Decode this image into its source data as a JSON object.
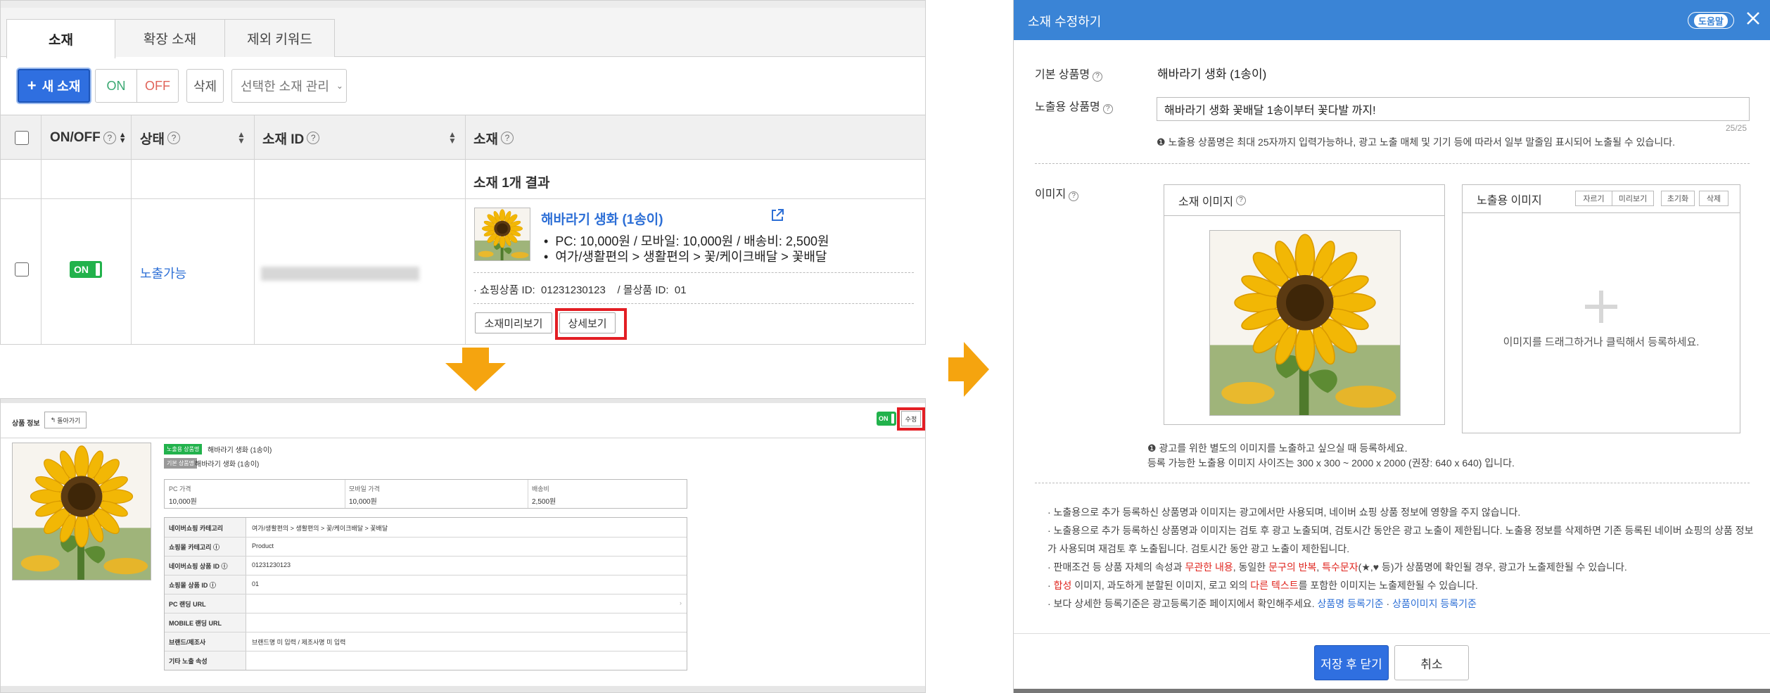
{
  "list_panel": {
    "tabs": [
      "소재",
      "확장 소재",
      "제외 키워드"
    ],
    "toolbar": {
      "new_label": "새 소재",
      "on_label": "ON",
      "off_label": "OFF",
      "delete_label": "삭제",
      "manage_label": "선택한 소재 관리"
    },
    "columns": [
      "ON/OFF",
      "상태",
      "소재 ID",
      "소재"
    ],
    "result_text": "소재 1개 결과",
    "row": {
      "toggle_label": "ON",
      "status": "노출가능",
      "product_title": "해바라기 생화 (1송이)",
      "bullet_1": "PC: 10,000원 / 모바일: 10,000원 / 배송비: 2,500원",
      "bullet_2": "여가/생활편의 > 생활편의 > 꽃/케이크배달 > 꽃배달",
      "ids_text": "· 쇼핑상품 ID:  01231230123    / 몰상품 ID:  01",
      "preview_btn": "소재미리보기",
      "detail_btn": "상세보기"
    }
  },
  "detail_panel": {
    "title": "상품 정보",
    "back_btn": "돌아가기",
    "on_label": "ON",
    "edit_btn": "수정",
    "badge_exposed": "노출용 상품명",
    "exposed_name": "해바라기 생화 (1송이)",
    "badge_basic": "기본 상품명",
    "basic_name": "해바라기 생화 (1송이)",
    "price_headers": [
      "PC 가격",
      "모바일 가격",
      "배송비"
    ],
    "price_values": [
      "10,000원",
      "10,000원",
      "2,500원"
    ],
    "rows": [
      {
        "label": "네이버쇼핑 카테고리",
        "value": "여가/생활편의 > 생활편의 > 꽃/케이크배달 > 꽃배달"
      },
      {
        "label": "쇼핑몰 카테고리",
        "value": "Product"
      },
      {
        "label": "네이버쇼핑 상품 ID",
        "value": "01231230123"
      },
      {
        "label": "쇼핑몰 상품 ID",
        "value": "01"
      },
      {
        "label": "PC 랜딩 URL",
        "value": ""
      },
      {
        "label": "MOBILE 랜딩 URL",
        "value": ""
      },
      {
        "label": "브랜드/제조사",
        "value": "브랜드명 미 입력 / 제조사명 미 입력"
      },
      {
        "label": "기타 노출 속성",
        "value": ""
      }
    ]
  },
  "modal": {
    "title": "소재 수정하기",
    "help_btn": "도움말",
    "close_icon": "close-icon",
    "basic_label": "기본 상품명",
    "basic_value": "해바라기 생화 (1송이)",
    "exposed_label": "노출용 상품명",
    "exposed_value": "해바라기 생화 꽃배달 1송이부터 꽃다발 까지!",
    "char_count": "25/25",
    "exposed_note": "노출용 상품명은 최대 25자까지 입력가능하나, 광고 노출 매체 및 기기 등에 따라서 일부 말줄임 표시되어 노출될 수 있습니다.",
    "image_label": "이미지",
    "ad_image_title": "소재 이미지",
    "exposed_image_title": "노출용 이미지",
    "image_buttons": [
      "자르기",
      "미리보기",
      "초기화",
      "삭제"
    ],
    "drop_text": "이미지를 드래그하거나 클릭해서 등록하세요.",
    "image_note_1": "광고를 위한 별도의 이미지를 노출하고 싶으실 때 등록하세요.",
    "image_note_2": "등록 가능한 노출용 이미지 사이즈는 300 x 300 ~ 2000 x 2000 (권장: 640 x 640) 입니다.",
    "guides": {
      "g1": "· 노출용으로 추가 등록하신 상품명과 이미지는 광고에서만 사용되며, 네이버 쇼핑 상품 정보에 영향을 주지 않습니다.",
      "g2a": "· 노출용으로 추가 등록하신 상품명과 이미지는 검토 후 광고 노출되며, 검토시간 동안은 광고 노출이 제한됩니다. 노출용 정보를 삭제하면 기존 등록된 네이버 쇼핑의 상품 정보",
      "g2b": "가 사용되며 재검토 후 노출됩니다. 검토시간 동안 광고 노출이 제한됩니다.",
      "g3_pre": "· 판매조건 등 상품 자체의 속성과 ",
      "g3_r1": "무관한 내용",
      "g3_mid1": ", 동일한 ",
      "g3_r2": "문구의 반복",
      "g3_mid2": ", ",
      "g3_r3": "특수문자",
      "g3_post": "(★,♥ 등)가 상품명에 확인될 경우, 광고가 노출제한될 수 있습니다.",
      "g4_pre": "· ",
      "g4_r1": "합성",
      "g4_mid": " 이미지, 과도하게 분할된 이미지, 로고 외의 ",
      "g4_r2": "다른 텍스트",
      "g4_post": "를 포함한 이미지는 노출제한될 수 있습니다.",
      "g5_pre": "· 보다 상세한 등록기준은 광고등록기준 페이지에서 확인해주세요. ",
      "g5_link1": "상품명 등록기준",
      "g5_sep": " · ",
      "g5_link2": "상품이미지 등록기준"
    },
    "save_btn": "저장 후 닫기",
    "cancel_btn": "취소"
  },
  "colors": {
    "accent_blue": "#3a84d6",
    "on_green": "#22b24c",
    "highlight_red": "#e31e24",
    "arrow_orange": "#f5a40f"
  }
}
